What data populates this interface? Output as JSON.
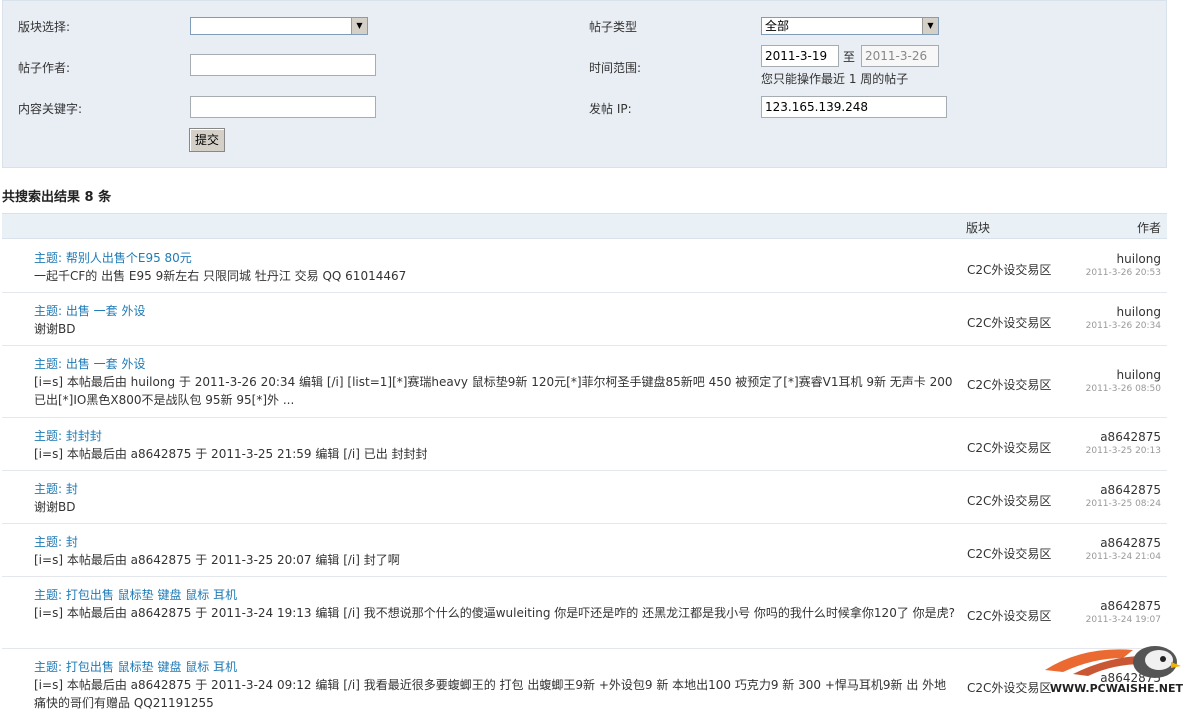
{
  "form": {
    "forum_label": "版块选择:",
    "forum_value": "",
    "author_label": "帖子作者:",
    "author_value": "",
    "keyword_label": "内容关键字:",
    "keyword_value": "",
    "submit_label": "提交",
    "type_label": "帖子类型",
    "type_value": "全部",
    "time_label": "时间范围:",
    "time_from": "2011-3-19",
    "time_to_sep": "至",
    "time_to": "2011-3-26",
    "time_note": "您只能操作最近 1 周的帖子",
    "ip_label": "发帖 IP:",
    "ip_value": "123.165.139.248"
  },
  "results": {
    "count_text": "共搜索出结果 8 条",
    "col_forum": "版块",
    "col_author": "作者",
    "rows": [
      {
        "subject": "主题: 帮别人出售个E95 80元",
        "excerpt": "一起千CF的 出售 E95 9新左右 只限同城 牡丹江 交易 QQ 61014467",
        "forum": "C2C外设交易区",
        "author": "huilong",
        "time": "2011-3-26 20:53"
      },
      {
        "subject": "主题: 出售 一套 外设",
        "excerpt": "谢谢BD",
        "forum": "C2C外设交易区",
        "author": "huilong",
        "time": "2011-3-26 20:34"
      },
      {
        "subject": "主题: 出售 一套 外设",
        "excerpt": "[i=s] 本帖最后由 huilong 于 2011-3-26 20:34 编辑 [/i] [list=1][*]赛瑞heavy 鼠标垫9新 120元[*]菲尔柯圣手键盘85新吧 450 被预定了[*]赛睿V1耳机 9新 无声卡 200 已出[*]IO黑色X800不是战队包 95新 95[*]外 ...",
        "forum": "C2C外设交易区",
        "author": "huilong",
        "time": "2011-3-26 08:50"
      },
      {
        "subject": "主题: 封封封",
        "excerpt": "[i=s] 本帖最后由 a8642875 于 2011-3-25 21:59 编辑 [/i] 已出 封封封",
        "forum": "C2C外设交易区",
        "author": "a8642875",
        "time": "2011-3-25 20:13"
      },
      {
        "subject": "主题: 封",
        "excerpt": "谢谢BD",
        "forum": "C2C外设交易区",
        "author": "a8642875",
        "time": "2011-3-25 08:24"
      },
      {
        "subject": "主题: 封",
        "excerpt": "[i=s] 本帖最后由 a8642875 于 2011-3-25 20:07 编辑 [/i] 封了啊",
        "forum": "C2C外设交易区",
        "author": "a8642875",
        "time": "2011-3-24 21:04"
      },
      {
        "subject": "主题: 打包出售 鼠标垫 键盘 鼠标 耳机",
        "excerpt": "[i=s] 本帖最后由 a8642875 于 2011-3-24 19:13 编辑 [/i] 我不想说那个什么的傻逼wuleiting 你是吓还是咋的 还黑龙江都是我小号 你吗的我什么时候拿你120了 你是虎?",
        "forum": "C2C外设交易区",
        "author": "a8642875",
        "time": "2011-3-24 19:07"
      },
      {
        "subject": "主题: 打包出售 鼠标垫 键盘 鼠标 耳机",
        "excerpt": "[i=s] 本帖最后由 a8642875 于 2011-3-24 09:12 编辑 [/i] 我看最近很多要蝮蝍王的 打包 出蝮蝍王9新 +外设包9 新 本地出100 巧克力9 新 300 +悍马耳机9新 出 外地 痛快的哥们有赠品 QQ21191255",
        "forum": "C2C外设交易区",
        "author": "a8642875",
        "time": ""
      }
    ]
  },
  "watermark": {
    "text": "WWW.PCWAISHE.NET"
  }
}
